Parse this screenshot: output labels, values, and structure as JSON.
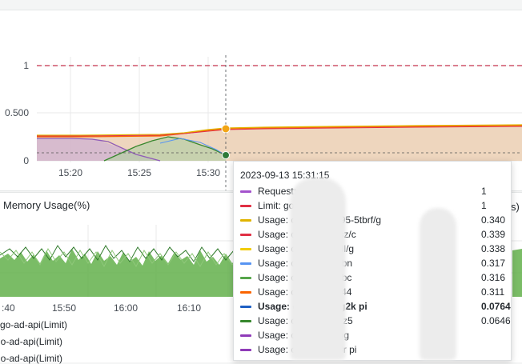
{
  "top_chart": {
    "y_ticks": [
      "1",
      "0.500",
      "0"
    ],
    "x_ticks": [
      "15:20",
      "15:25",
      "15:30"
    ]
  },
  "memory_panel": {
    "title": "Memory Usage(%)",
    "x_ticks": [
      ":40",
      "15:50",
      "16:00",
      "16:10"
    ],
    "legend": [
      "go-ad-api(Limit)",
      "go-ad-api(Limit)",
      "go-ad-api(Limit)"
    ],
    "right_edge_text": "s)"
  },
  "tooltip": {
    "time": "2023-09-13 15:31:15",
    "rows": [
      {
        "label": "Request: c",
        "value": "1",
        "color": "#a352cc",
        "bold": false
      },
      {
        "label": "Limit: go",
        "value": "1",
        "color": "#e02f44",
        "bold": false
      },
      {
        "label": "Usage: c        api    5cd7495-5tbrf/g",
        "value": "0.340",
        "color": "#e0b400",
        "bold": false
      },
      {
        "label": "Usage:                  cd7495-6tbsz/c",
        "value": "0.339",
        "color": "#e02f44",
        "bold": false
      },
      {
        "label": "Usage:                  cd7495-z5fdl/g",
        "value": "0.338",
        "color": "#f2cc0c",
        "bold": false
      },
      {
        "label": "Usage:                  cd7495-694bn",
        "value": "0.317",
        "color": "#5794f2",
        "bold": false
      },
      {
        "label": "Usage:                  cd7495-57hbc",
        "value": "0.316",
        "color": "#56a64b",
        "bold": false
      },
      {
        "label": "Usage:                  cd7495-6s944",
        "value": "0.311",
        "color": "#fa6400",
        "bold": false
      },
      {
        "label": "Usage:                  cd7495-8hg2k               pi",
        "value": "0.0764",
        "color": "#1f60c4",
        "bold": true
      },
      {
        "label": "Usage:                  cd7495-vwqz5",
        "value": "0.0646",
        "color": "#37872d",
        "bold": false
      },
      {
        "label": "Usage:                  cd7495-fxgpg",
        "value": "",
        "color": "#8f3bb8",
        "bold": false
      },
      {
        "label": "Usage:                  cd7495-pw8r               pi",
        "value": "",
        "color": "#8f3bb8",
        "bold": false
      }
    ]
  }
}
